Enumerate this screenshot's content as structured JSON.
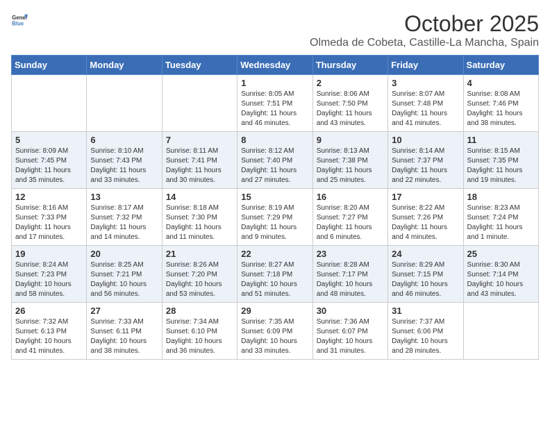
{
  "header": {
    "logo_general": "General",
    "logo_blue": "Blue",
    "month": "October 2025",
    "location": "Olmeda de Cobeta, Castille-La Mancha, Spain"
  },
  "weekdays": [
    "Sunday",
    "Monday",
    "Tuesday",
    "Wednesday",
    "Thursday",
    "Friday",
    "Saturday"
  ],
  "weeks": [
    [
      {
        "day": "",
        "info": ""
      },
      {
        "day": "",
        "info": ""
      },
      {
        "day": "",
        "info": ""
      },
      {
        "day": "1",
        "info": "Sunrise: 8:05 AM\nSunset: 7:51 PM\nDaylight: 11 hours and 46 minutes."
      },
      {
        "day": "2",
        "info": "Sunrise: 8:06 AM\nSunset: 7:50 PM\nDaylight: 11 hours and 43 minutes."
      },
      {
        "day": "3",
        "info": "Sunrise: 8:07 AM\nSunset: 7:48 PM\nDaylight: 11 hours and 41 minutes."
      },
      {
        "day": "4",
        "info": "Sunrise: 8:08 AM\nSunset: 7:46 PM\nDaylight: 11 hours and 38 minutes."
      }
    ],
    [
      {
        "day": "5",
        "info": "Sunrise: 8:09 AM\nSunset: 7:45 PM\nDaylight: 11 hours and 35 minutes."
      },
      {
        "day": "6",
        "info": "Sunrise: 8:10 AM\nSunset: 7:43 PM\nDaylight: 11 hours and 33 minutes."
      },
      {
        "day": "7",
        "info": "Sunrise: 8:11 AM\nSunset: 7:41 PM\nDaylight: 11 hours and 30 minutes."
      },
      {
        "day": "8",
        "info": "Sunrise: 8:12 AM\nSunset: 7:40 PM\nDaylight: 11 hours and 27 minutes."
      },
      {
        "day": "9",
        "info": "Sunrise: 8:13 AM\nSunset: 7:38 PM\nDaylight: 11 hours and 25 minutes."
      },
      {
        "day": "10",
        "info": "Sunrise: 8:14 AM\nSunset: 7:37 PM\nDaylight: 11 hours and 22 minutes."
      },
      {
        "day": "11",
        "info": "Sunrise: 8:15 AM\nSunset: 7:35 PM\nDaylight: 11 hours and 19 minutes."
      }
    ],
    [
      {
        "day": "12",
        "info": "Sunrise: 8:16 AM\nSunset: 7:33 PM\nDaylight: 11 hours and 17 minutes."
      },
      {
        "day": "13",
        "info": "Sunrise: 8:17 AM\nSunset: 7:32 PM\nDaylight: 11 hours and 14 minutes."
      },
      {
        "day": "14",
        "info": "Sunrise: 8:18 AM\nSunset: 7:30 PM\nDaylight: 11 hours and 11 minutes."
      },
      {
        "day": "15",
        "info": "Sunrise: 8:19 AM\nSunset: 7:29 PM\nDaylight: 11 hours and 9 minutes."
      },
      {
        "day": "16",
        "info": "Sunrise: 8:20 AM\nSunset: 7:27 PM\nDaylight: 11 hours and 6 minutes."
      },
      {
        "day": "17",
        "info": "Sunrise: 8:22 AM\nSunset: 7:26 PM\nDaylight: 11 hours and 4 minutes."
      },
      {
        "day": "18",
        "info": "Sunrise: 8:23 AM\nSunset: 7:24 PM\nDaylight: 11 hours and 1 minute."
      }
    ],
    [
      {
        "day": "19",
        "info": "Sunrise: 8:24 AM\nSunset: 7:23 PM\nDaylight: 10 hours and 58 minutes."
      },
      {
        "day": "20",
        "info": "Sunrise: 8:25 AM\nSunset: 7:21 PM\nDaylight: 10 hours and 56 minutes."
      },
      {
        "day": "21",
        "info": "Sunrise: 8:26 AM\nSunset: 7:20 PM\nDaylight: 10 hours and 53 minutes."
      },
      {
        "day": "22",
        "info": "Sunrise: 8:27 AM\nSunset: 7:18 PM\nDaylight: 10 hours and 51 minutes."
      },
      {
        "day": "23",
        "info": "Sunrise: 8:28 AM\nSunset: 7:17 PM\nDaylight: 10 hours and 48 minutes."
      },
      {
        "day": "24",
        "info": "Sunrise: 8:29 AM\nSunset: 7:15 PM\nDaylight: 10 hours and 46 minutes."
      },
      {
        "day": "25",
        "info": "Sunrise: 8:30 AM\nSunset: 7:14 PM\nDaylight: 10 hours and 43 minutes."
      }
    ],
    [
      {
        "day": "26",
        "info": "Sunrise: 7:32 AM\nSunset: 6:13 PM\nDaylight: 10 hours and 41 minutes."
      },
      {
        "day": "27",
        "info": "Sunrise: 7:33 AM\nSunset: 6:11 PM\nDaylight: 10 hours and 38 minutes."
      },
      {
        "day": "28",
        "info": "Sunrise: 7:34 AM\nSunset: 6:10 PM\nDaylight: 10 hours and 36 minutes."
      },
      {
        "day": "29",
        "info": "Sunrise: 7:35 AM\nSunset: 6:09 PM\nDaylight: 10 hours and 33 minutes."
      },
      {
        "day": "30",
        "info": "Sunrise: 7:36 AM\nSunset: 6:07 PM\nDaylight: 10 hours and 31 minutes."
      },
      {
        "day": "31",
        "info": "Sunrise: 7:37 AM\nSunset: 6:06 PM\nDaylight: 10 hours and 28 minutes."
      },
      {
        "day": "",
        "info": ""
      }
    ]
  ]
}
